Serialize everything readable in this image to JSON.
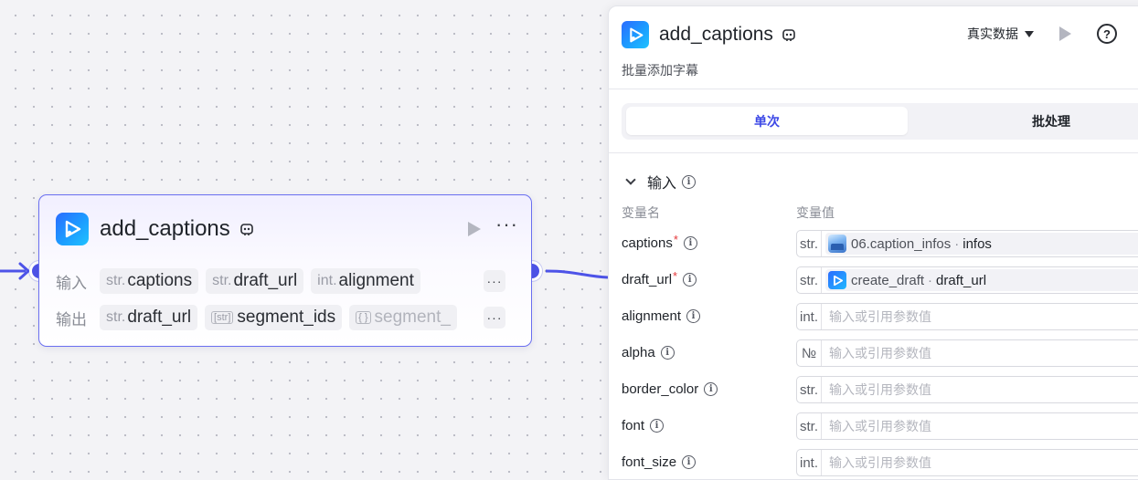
{
  "node": {
    "title": "add_captions",
    "input_label": "输入",
    "output_label": "输出",
    "inputs": [
      {
        "type": "str.",
        "name": "captions"
      },
      {
        "type": "str.",
        "name": "draft_url"
      },
      {
        "type": "int.",
        "name": "alignment"
      }
    ],
    "outputs": [
      {
        "type": "str.",
        "name": "draft_url"
      },
      {
        "type": "[str]",
        "name": "segment_ids"
      },
      {
        "type": "{ }",
        "name": "segment_"
      }
    ],
    "more_label": "···"
  },
  "panel": {
    "title": "add_captions",
    "description": "批量添加字幕",
    "dataset": "真实数据",
    "help": "?",
    "more": "⋮",
    "tabs": [
      {
        "label": "单次",
        "active": true
      },
      {
        "label": "批处理",
        "active": false
      }
    ],
    "section": "输入",
    "col_name": "变量名",
    "col_value": "变量值",
    "params": [
      {
        "name": "captions",
        "required": "*",
        "type": "str.",
        "ref_source": "06.caption_infos",
        "ref_sep": "·",
        "ref_var": "infos"
      },
      {
        "name": "draft_url",
        "required": "*",
        "type": "str.",
        "ref_source": "create_draft",
        "ref_sep": "·",
        "ref_var": "draft_url"
      },
      {
        "name": "alignment",
        "type": "int.",
        "placeholder": "输入或引用参数值"
      },
      {
        "name": "alpha",
        "type": "№",
        "placeholder": "输入或引用参数值"
      },
      {
        "name": "border_color",
        "type": "str.",
        "placeholder": "输入或引用参数值"
      },
      {
        "name": "font",
        "type": "str.",
        "placeholder": "输入或引用参数值"
      },
      {
        "name": "font_size",
        "type": "int.",
        "placeholder": "输入或引用参数值"
      }
    ]
  },
  "colors": {
    "accent": "#4d53e8",
    "active_tab_text": "#3c48e6",
    "required": "#e5383b"
  },
  "icons": [
    "app-play-icon",
    "smart-toolbox-icon",
    "run-play-icon",
    "more-dots-icon",
    "help-circle-icon",
    "chevron-down-icon",
    "info-icon",
    "caret-down-icon"
  ]
}
